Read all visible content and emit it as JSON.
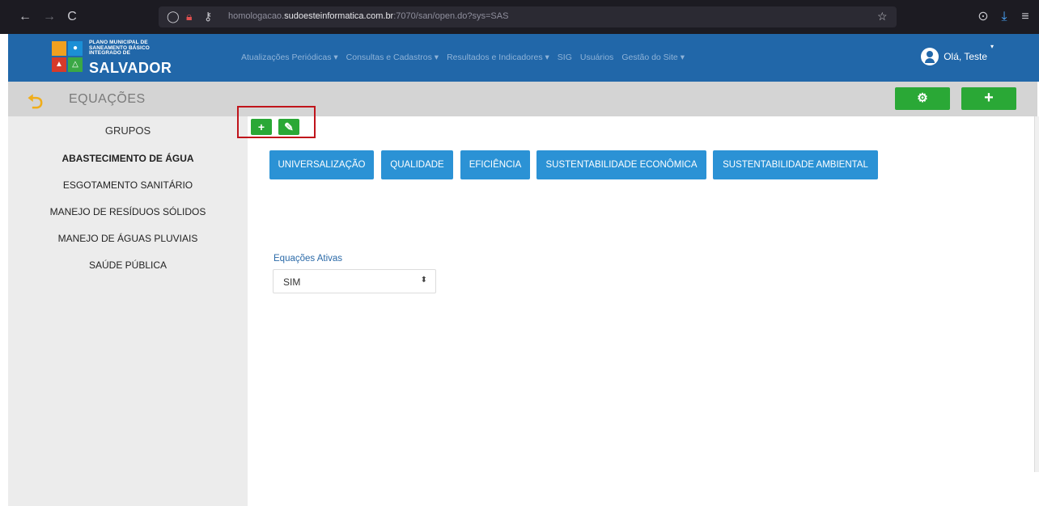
{
  "browser": {
    "back": "←",
    "forward": "→",
    "reload": "C",
    "url_prefix": "homologacao.",
    "url_host": "sudoesteinformatica.com.br",
    "url_suffix": ":7070/san/open.do?sys=SAS",
    "star": "☆",
    "pocket": "⊙",
    "download": "⤓",
    "menu": "≡"
  },
  "header": {
    "logo_small_line1": "PLANO MUNICIPAL DE",
    "logo_small_line2": "SANEAMENTO BÁSICO",
    "logo_small_line3": "INTEGRADO DE",
    "logo_big": "SALVADOR",
    "menu": [
      "Atualizações Periódicas ▾",
      "Consultas e Cadastros ▾",
      "Resultados e Indicadores ▾",
      "SIG",
      "Usuários",
      "Gestão do Site ▾"
    ],
    "user_greeting": "Olá, Teste"
  },
  "title_bar": {
    "title": "EQUAÇÕES",
    "settings_glyph": "⚙",
    "add_glyph": "+"
  },
  "sidebar": {
    "heading": "GRUPOS",
    "items": [
      "ABASTECIMENTO DE ÁGUA",
      "ESGOTAMENTO SANITÁRIO",
      "MANEJO DE RESÍDUOS SÓLIDOS",
      "MANEJO DE ÁGUAS PLUVIAIS",
      "SAÚDE PÚBLICA"
    ],
    "active_index": 0
  },
  "actions": {
    "add_glyph": "+",
    "edit_glyph": "✎"
  },
  "tabs": [
    "UNIVERSALIZAÇÃO",
    "QUALIDADE",
    "EFICIÊNCIA",
    "SUSTENTABILIDADE ECONÔMICA",
    "SUSTENTABILIDADE AMBIENTAL"
  ],
  "filter": {
    "label": "Equações Ativas",
    "value": "SIM",
    "arrow": "⬍"
  },
  "colors": {
    "header_blue": "#2167a9",
    "tab_blue": "#2b92d5",
    "green": "#2aa836",
    "highlight_red": "#c0141b"
  }
}
